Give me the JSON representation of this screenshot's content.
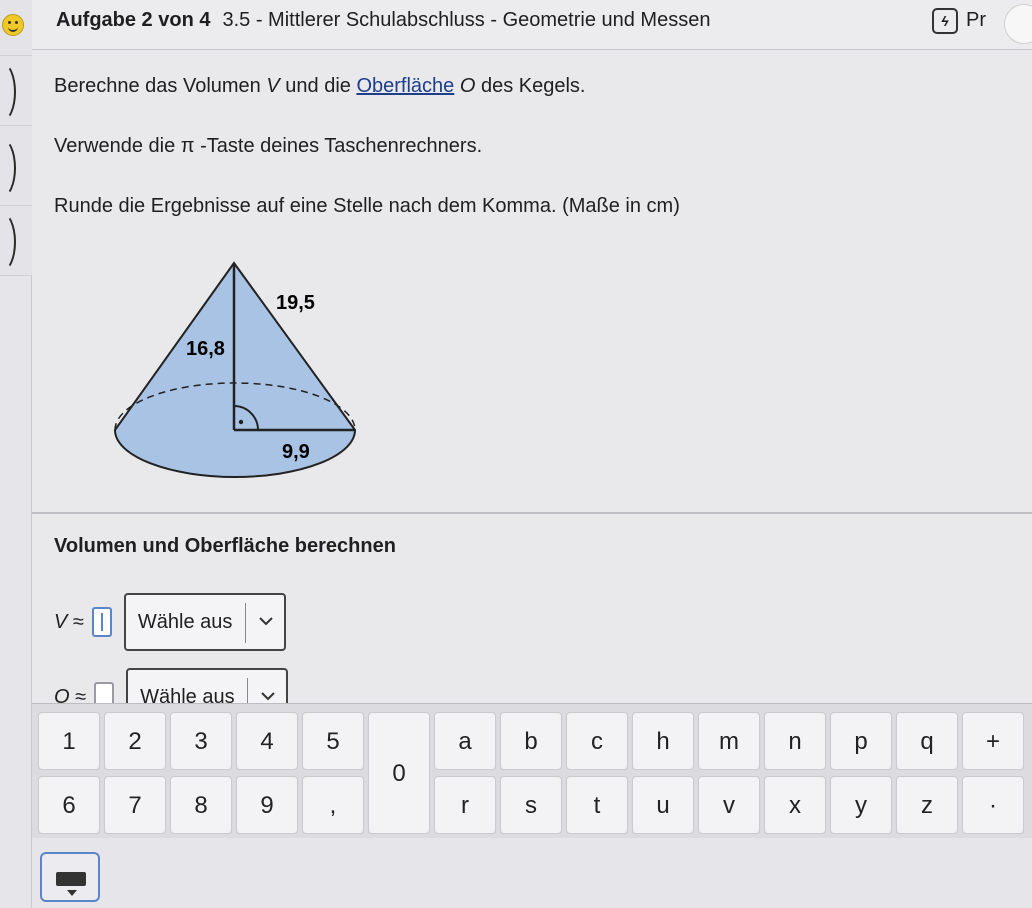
{
  "header": {
    "task_counter": "Aufgabe 2 von 4",
    "title": "3.5 - Mittlerer Schulabschluss - Geometrie und Messen",
    "hint_icon_text": "ϟ",
    "hint_label": "Pr"
  },
  "instructions": {
    "line1_pre": "Berechne das Volumen ",
    "line1_V": "V",
    "line1_mid": " und die ",
    "line1_link": "Oberfläche",
    "line1_O": " O",
    "line1_post": " des Kegels.",
    "line2": "Verwende die π -Taste deines Taschenrechners.",
    "line3": "Runde die Ergebnisse auf eine Stelle nach dem Komma. (Maße in cm)"
  },
  "figure": {
    "slant": "19,5",
    "height": "16,8",
    "radius": "9,9",
    "colors": {
      "fill": "#a9c3e5",
      "stroke": "#222222"
    }
  },
  "section": {
    "title": "Volumen und Oberfläche berechnen"
  },
  "answers": {
    "volume": {
      "label": "V",
      "approx": " ≈",
      "value": "",
      "unit_select": "Wähle aus"
    },
    "surface": {
      "label": "O",
      "approx": " ≈",
      "value": "",
      "unit_select": "Wähle aus"
    }
  },
  "keyboard": {
    "row1": [
      "1",
      "2",
      "3",
      "4",
      "5"
    ],
    "row2": [
      "6",
      "7",
      "8",
      "9",
      ","
    ],
    "zero": "0",
    "letters_row1": [
      "a",
      "b",
      "c",
      "h",
      "m",
      "n",
      "p",
      "q",
      "+"
    ],
    "letters_row2": [
      "r",
      "s",
      "t",
      "u",
      "v",
      "x",
      "y",
      "z",
      "·"
    ]
  },
  "colors": {
    "accent": "#5a86c8",
    "keyboard_bg": "#dcdce0"
  }
}
